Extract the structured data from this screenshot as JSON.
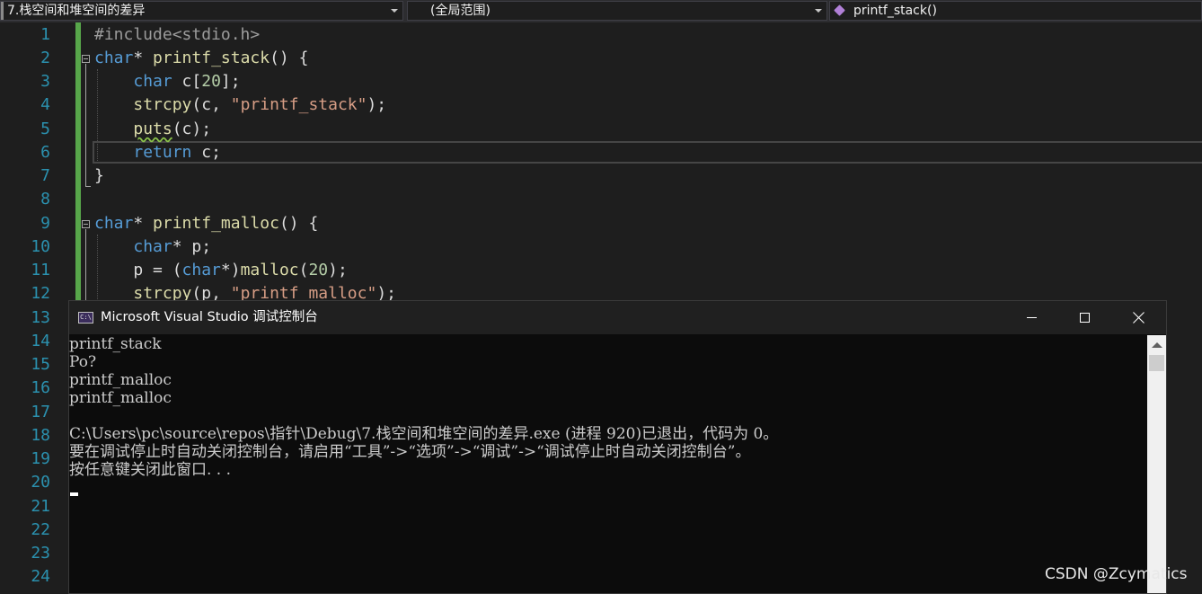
{
  "navbar": {
    "file_dropdown": "7.栈空间和堆空间的差异",
    "scope_dropdown": "(全局范围)",
    "member_dropdown": "printf_stack()",
    "member_icon": "method-icon"
  },
  "editor": {
    "line_numbers": [
      "1",
      "2",
      "3",
      "4",
      "5",
      "6",
      "7",
      "8",
      "9",
      "10",
      "11",
      "12",
      "13",
      "14",
      "15",
      "16",
      "17",
      "18",
      "19",
      "20",
      "21",
      "22",
      "23",
      "24"
    ],
    "current_line": 6,
    "code_lines": [
      "#include<stdio.h>",
      "char* printf_stack() {",
      "    char c[20];",
      "    strcpy(c, \"printf_stack\");",
      "    puts(c);",
      "    return c;",
      "}",
      "",
      "char* printf_malloc() {",
      "    char* p;",
      "    p = (char*)malloc(20);",
      "    strcpy(p, \"printf_malloc\");"
    ],
    "colors": {
      "keyword": "#569cd6",
      "function": "#dcdcaa",
      "string": "#d69d85",
      "number": "#b5cea8",
      "line_number": "#2b91af",
      "change_bar": "#57a64a"
    }
  },
  "console": {
    "title": "Microsoft Visual Studio 调试控制台",
    "icon_text": "C:\\",
    "output_lines": [
      "printf_stack",
      "Po?",
      "printf_malloc",
      "printf_malloc",
      "",
      "C:\\Users\\pc\\source\\repos\\指针\\Debug\\7.栈空间和堆空间的差异.exe (进程 920)已退出，代码为 0。",
      "要在调试停止时自动关闭控制台，请启用“工具”->“选项”->“调试”->“调试停止时自动关闭控制台”。",
      "按任意键关闭此窗口. . ."
    ]
  },
  "watermark": "CSDN @Zcymatics"
}
